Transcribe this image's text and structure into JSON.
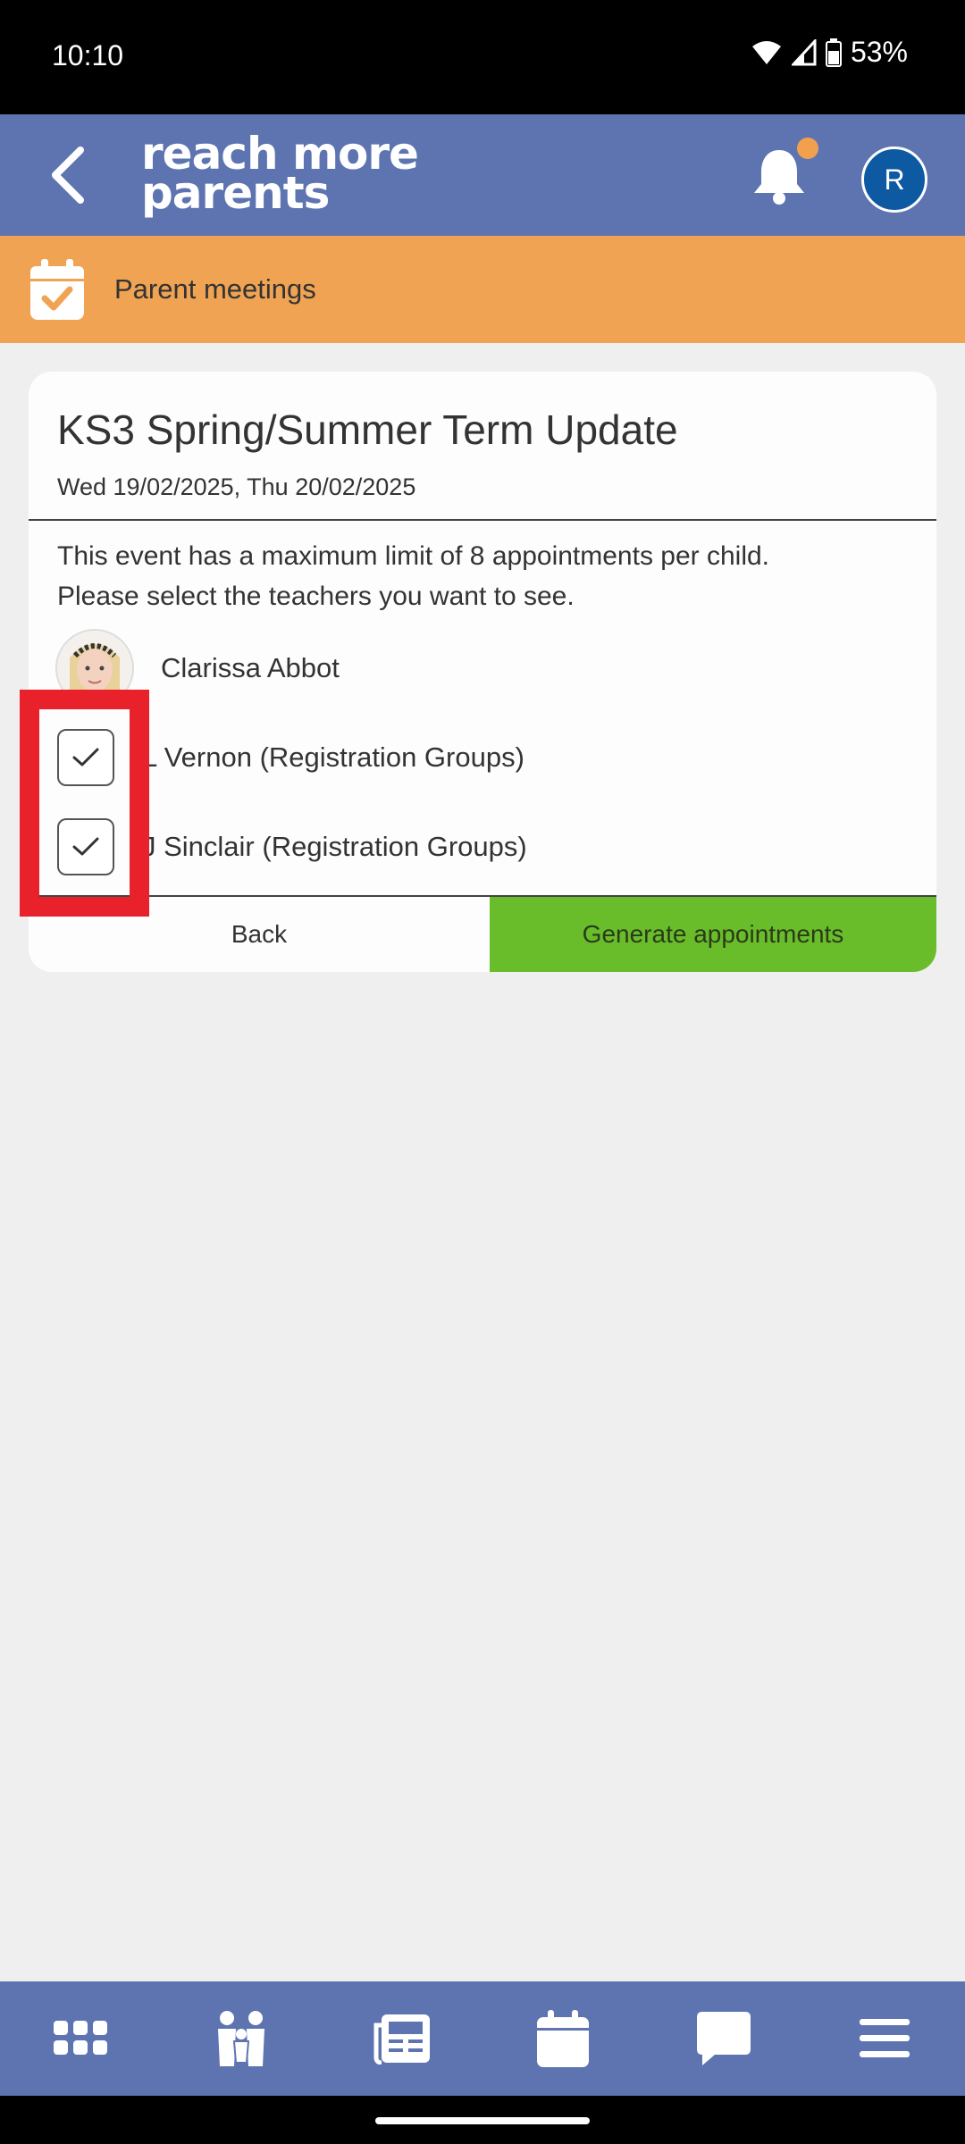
{
  "status_bar": {
    "time": "10:10",
    "battery": "53%"
  },
  "header": {
    "logo_line1": "reach more",
    "logo_line2": "parents",
    "avatar_initial": "R"
  },
  "banner": {
    "title": "Parent meetings",
    "icon": "calendar-check-icon"
  },
  "event": {
    "title": "KS3 Spring/Summer Term Update",
    "dates": "Wed 19/02/2025, Thu 20/02/2025",
    "info_line1": "This event has a maximum limit of 8 appointments per child.",
    "info_line2": "Please select the teachers you want to see.",
    "child_name": "Clarissa Abbot",
    "teachers": [
      {
        "label": "L Vernon (Registration Groups)",
        "checked": true
      },
      {
        "label": "J Sinclair (Registration Groups)",
        "checked": true
      }
    ]
  },
  "buttons": {
    "back": "Back",
    "generate": "Generate appointments"
  },
  "colors": {
    "header": "#5d74b1",
    "banner": "#f0a353",
    "generate": "#6abd2a",
    "highlight": "#e8212a"
  },
  "bottom_nav": [
    "dashboard-grid-icon",
    "family-icon",
    "newspaper-icon",
    "calendar-icon",
    "chat-icon",
    "menu-icon"
  ]
}
